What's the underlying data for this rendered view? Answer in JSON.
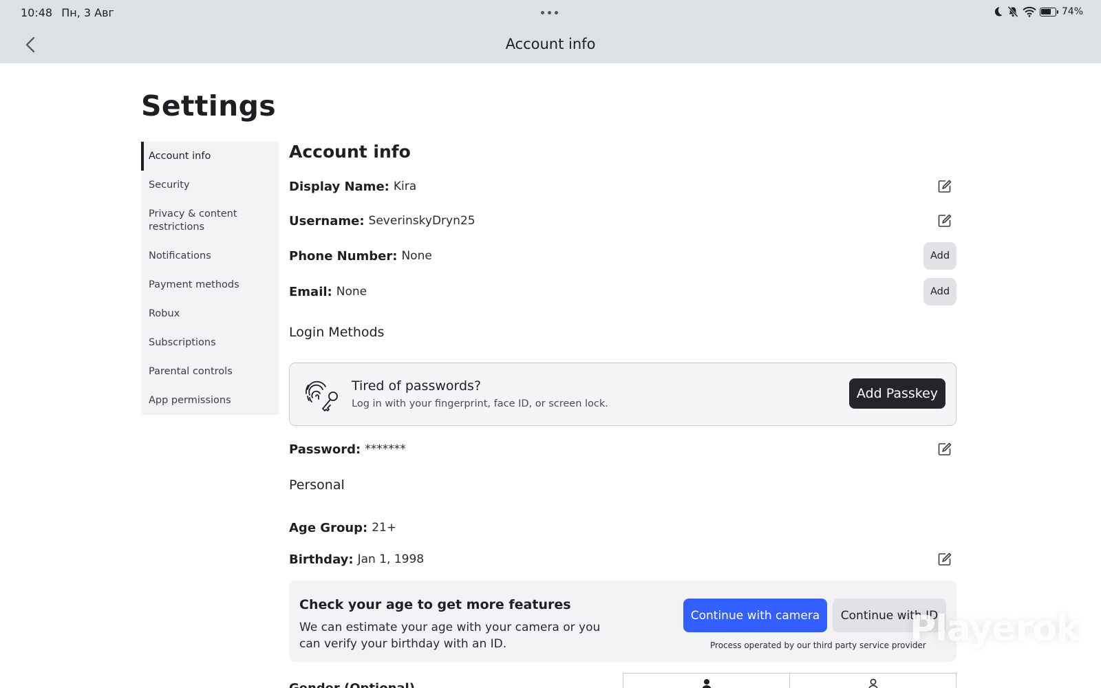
{
  "status_bar": {
    "time": "10:48",
    "date": "Пн, 3 Авг",
    "battery": "74%",
    "battery_level": 0.74
  },
  "nav": {
    "title": "Account info"
  },
  "page": {
    "title": "Settings"
  },
  "sidebar": {
    "items": [
      {
        "label": "Account info",
        "active": true
      },
      {
        "label": "Security"
      },
      {
        "label": "Privacy & content restrictions"
      },
      {
        "label": "Notifications"
      },
      {
        "label": "Payment methods"
      },
      {
        "label": "Robux"
      },
      {
        "label": "Subscriptions"
      },
      {
        "label": "Parental controls"
      },
      {
        "label": "App permissions"
      }
    ]
  },
  "account": {
    "section_title": "Account info",
    "display_name": {
      "label": "Display Name:",
      "value": "Kira"
    },
    "username": {
      "label": "Username:",
      "value": "SeverinskyDryn25"
    },
    "phone": {
      "label": "Phone Number:",
      "value": "None",
      "action": "Add"
    },
    "email": {
      "label": "Email:",
      "value": "None",
      "action": "Add"
    },
    "login_methods_title": "Login Methods",
    "passkey": {
      "title": "Tired of passwords?",
      "subtitle": "Log in with your fingerprint, face ID, or screen lock.",
      "button": "Add Passkey"
    },
    "password": {
      "label": "Password:",
      "value": "*******"
    },
    "personal_title": "Personal",
    "age_group": {
      "label": "Age Group:",
      "value": "21+"
    },
    "birthday": {
      "label": "Birthday:",
      "value": "Jan 1, 1998"
    },
    "age_check": {
      "title": "Check your age to get more features",
      "text": "We can estimate your age with your camera or you can verify your birthday with an ID.",
      "camera_button": "Continue with camera",
      "id_button": "Continue with ID",
      "note": "Process operated by our third party service provider"
    },
    "gender_label": "Gender (Optional)"
  },
  "watermark": "Playerok",
  "colors": {
    "primary_blue": "#335fff",
    "dark_button": "#23252b",
    "topbar_bg": "#dde0e4",
    "sidebar_bg": "#f3f3f5"
  }
}
